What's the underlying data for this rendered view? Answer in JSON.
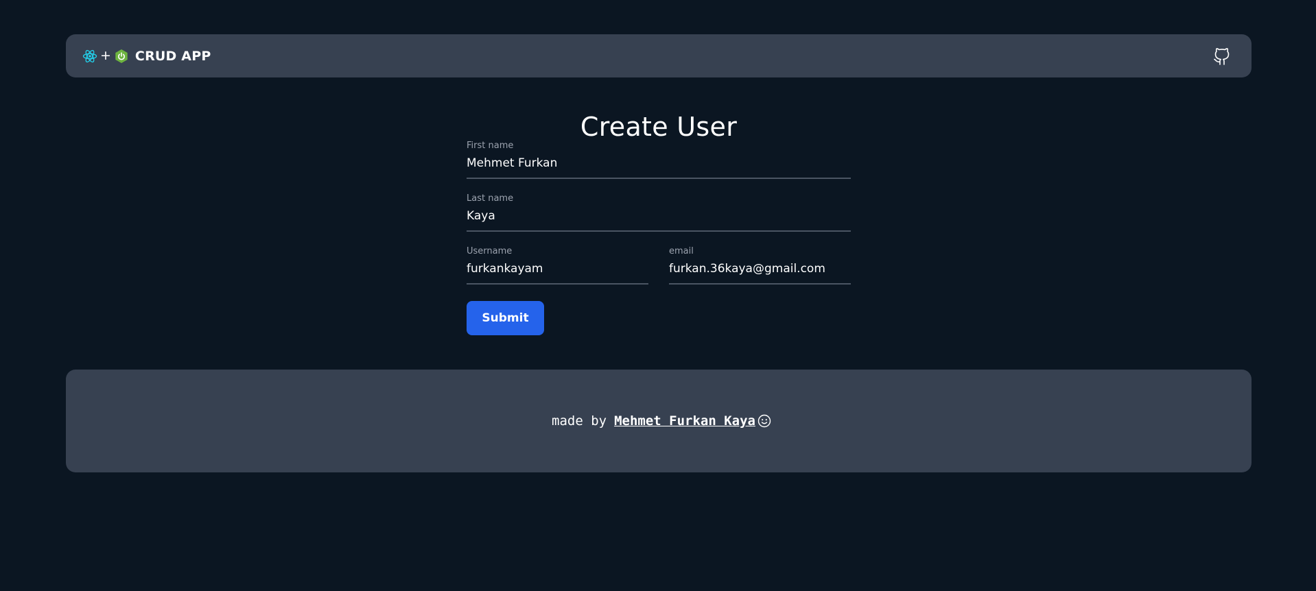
{
  "navbar": {
    "plus": "+",
    "title": "CRUD APP",
    "icons": [
      "react-icon",
      "spring-icon",
      "github-icon"
    ]
  },
  "form": {
    "title": "Create User",
    "first_name": {
      "label": "First name",
      "value": "Mehmet Furkan"
    },
    "last_name": {
      "label": "Last name",
      "value": "Kaya"
    },
    "username": {
      "label": "Username",
      "value": "furkankayam"
    },
    "email": {
      "label": "email",
      "value": "furkan.36kaya@gmail.com"
    },
    "submit_label": "Submit"
  },
  "footer": {
    "prefix": "made by",
    "author": "Mehmet Furkan Kaya",
    "icon": "smile-icon"
  },
  "colors": {
    "background": "#0b1622",
    "panel": "#374151",
    "accent": "#2563eb",
    "react": "#22d3ee",
    "spring": "#6db33f"
  }
}
